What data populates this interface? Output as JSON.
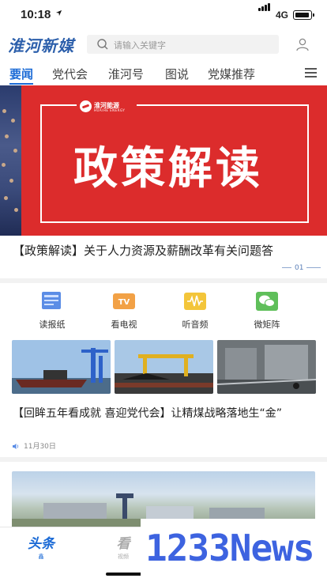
{
  "status_bar": {
    "time": "10:18",
    "network": "4G"
  },
  "header": {
    "logo": "淮河新媒",
    "search_placeholder": "请输入关键字"
  },
  "tabs": [
    {
      "label": "要闻",
      "active": true
    },
    {
      "label": "党代会"
    },
    {
      "label": "淮河号"
    },
    {
      "label": "图说"
    },
    {
      "label": "党媒推荐"
    }
  ],
  "banner": {
    "brand_name": "淮河能源",
    "brand_sub": "HUAIHE ENERGY",
    "title": "政策解读",
    "headline": "【政策解读】关于人力资源及薪酬改革有关问题答",
    "page": "01",
    "color": "#dc2c2c"
  },
  "quick_links": [
    {
      "label": "读报纸",
      "icon": "newspaper-icon",
      "color": "#5b8de6"
    },
    {
      "label": "看电视",
      "icon": "tv-icon",
      "color": "#f2a146"
    },
    {
      "label": "听音频",
      "icon": "audio-icon",
      "color": "#f3c53a"
    },
    {
      "label": "微矩阵",
      "icon": "wechat-icon",
      "color": "#5fbf5a"
    }
  ],
  "article": {
    "title": "【回眸五年看成就 喜迎党代会】让精煤战略落地生“金”",
    "date": "11月30日"
  },
  "bottom_nav": [
    {
      "label": "头条",
      "sub": "鑫",
      "active": true
    },
    {
      "label": "看",
      "sub": "视频"
    }
  ],
  "watermark": "1233News",
  "accent_color": "#1c6bd6"
}
